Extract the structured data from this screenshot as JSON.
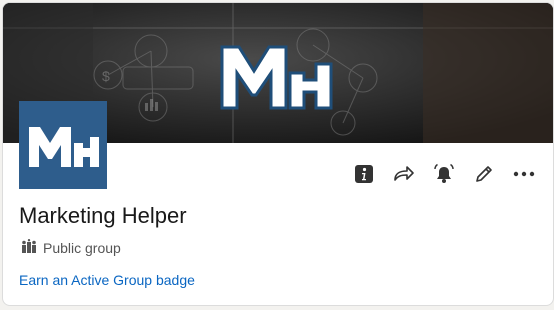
{
  "group": {
    "logo_text": "MH",
    "name": "Marketing Helper",
    "type_label": "Public group",
    "badge_link": "Earn an Active Group badge"
  },
  "actions": [
    {
      "icon": "info-icon"
    },
    {
      "icon": "share-icon"
    },
    {
      "icon": "bell-icon"
    },
    {
      "icon": "pencil-icon"
    },
    {
      "icon": "more-icon"
    }
  ],
  "colors": {
    "brand_blue": "#2e5d8c",
    "link_blue": "#0a66c2",
    "text_dark": "#191919",
    "text_muted": "#555555"
  }
}
